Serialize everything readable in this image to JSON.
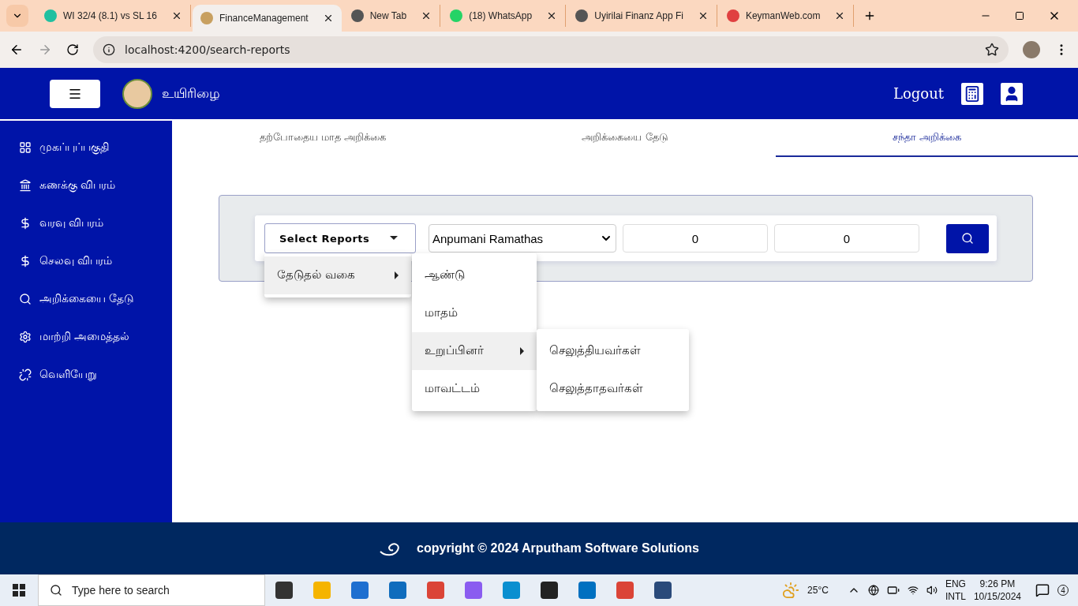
{
  "browser": {
    "tabs": [
      {
        "title": "WI 32/4 (8.1) vs SL 16",
        "selected": false
      },
      {
        "title": "FinanceManagement",
        "selected": true
      },
      {
        "title": "New Tab",
        "selected": false
      },
      {
        "title": "(18) WhatsApp",
        "selected": false
      },
      {
        "title": "Uyirilai Finanz App Fi",
        "selected": false
      },
      {
        "title": "KeymanWeb.com",
        "selected": false
      }
    ],
    "url": "localhost:4200/search-reports"
  },
  "header": {
    "app_name": "உயிரிழை",
    "logout": "Logout"
  },
  "sidebar": {
    "items": [
      {
        "label": "முகப்புப்பகுதி"
      },
      {
        "label": "கணக்கு விபரம்"
      },
      {
        "label": "வரவு விபரம்"
      },
      {
        "label": "செலவு விபரம்"
      },
      {
        "label": "அறிக்கையை தேடு"
      },
      {
        "label": "மாற்றி அமைத்தல்"
      },
      {
        "label": "வெளியேறு"
      }
    ]
  },
  "page_tabs": [
    {
      "label": "தற்போதைய மாத அறிக்கை",
      "selected": false
    },
    {
      "label": "அறிக்கையை தேடு",
      "selected": false
    },
    {
      "label": "சந்தா அறிக்கை",
      "selected": true
    }
  ],
  "search": {
    "report_button": "Select Reports",
    "member": "Anpumani Ramathas",
    "from": "0",
    "to": "0"
  },
  "menus": [
    [
      {
        "label": "தேடுதல் வகை",
        "submenu": true,
        "highlighted": true
      }
    ],
    [
      {
        "label": "ஆண்டு",
        "submenu": false,
        "highlighted": false
      },
      {
        "label": "மாதம்",
        "submenu": false,
        "highlighted": false
      },
      {
        "label": "உறுப்பினர்",
        "submenu": true,
        "highlighted": true
      },
      {
        "label": "மாவட்டம்",
        "submenu": false,
        "highlighted": false
      }
    ],
    [
      {
        "label": "செலுத்தியவர்கள்",
        "submenu": false,
        "highlighted": false
      },
      {
        "label": "செலுத்தாதவர்கள்",
        "submenu": false,
        "highlighted": false
      }
    ]
  ],
  "footer": {
    "copyright": "copyright © 2024 Arputham Software Solutions"
  },
  "taskbar": {
    "search_placeholder": "Type here to search",
    "temperature": "25°C",
    "language": "ENG",
    "layout": "INTL",
    "time": "9:26 PM",
    "date": "10/15/2024",
    "notifications": "4"
  }
}
